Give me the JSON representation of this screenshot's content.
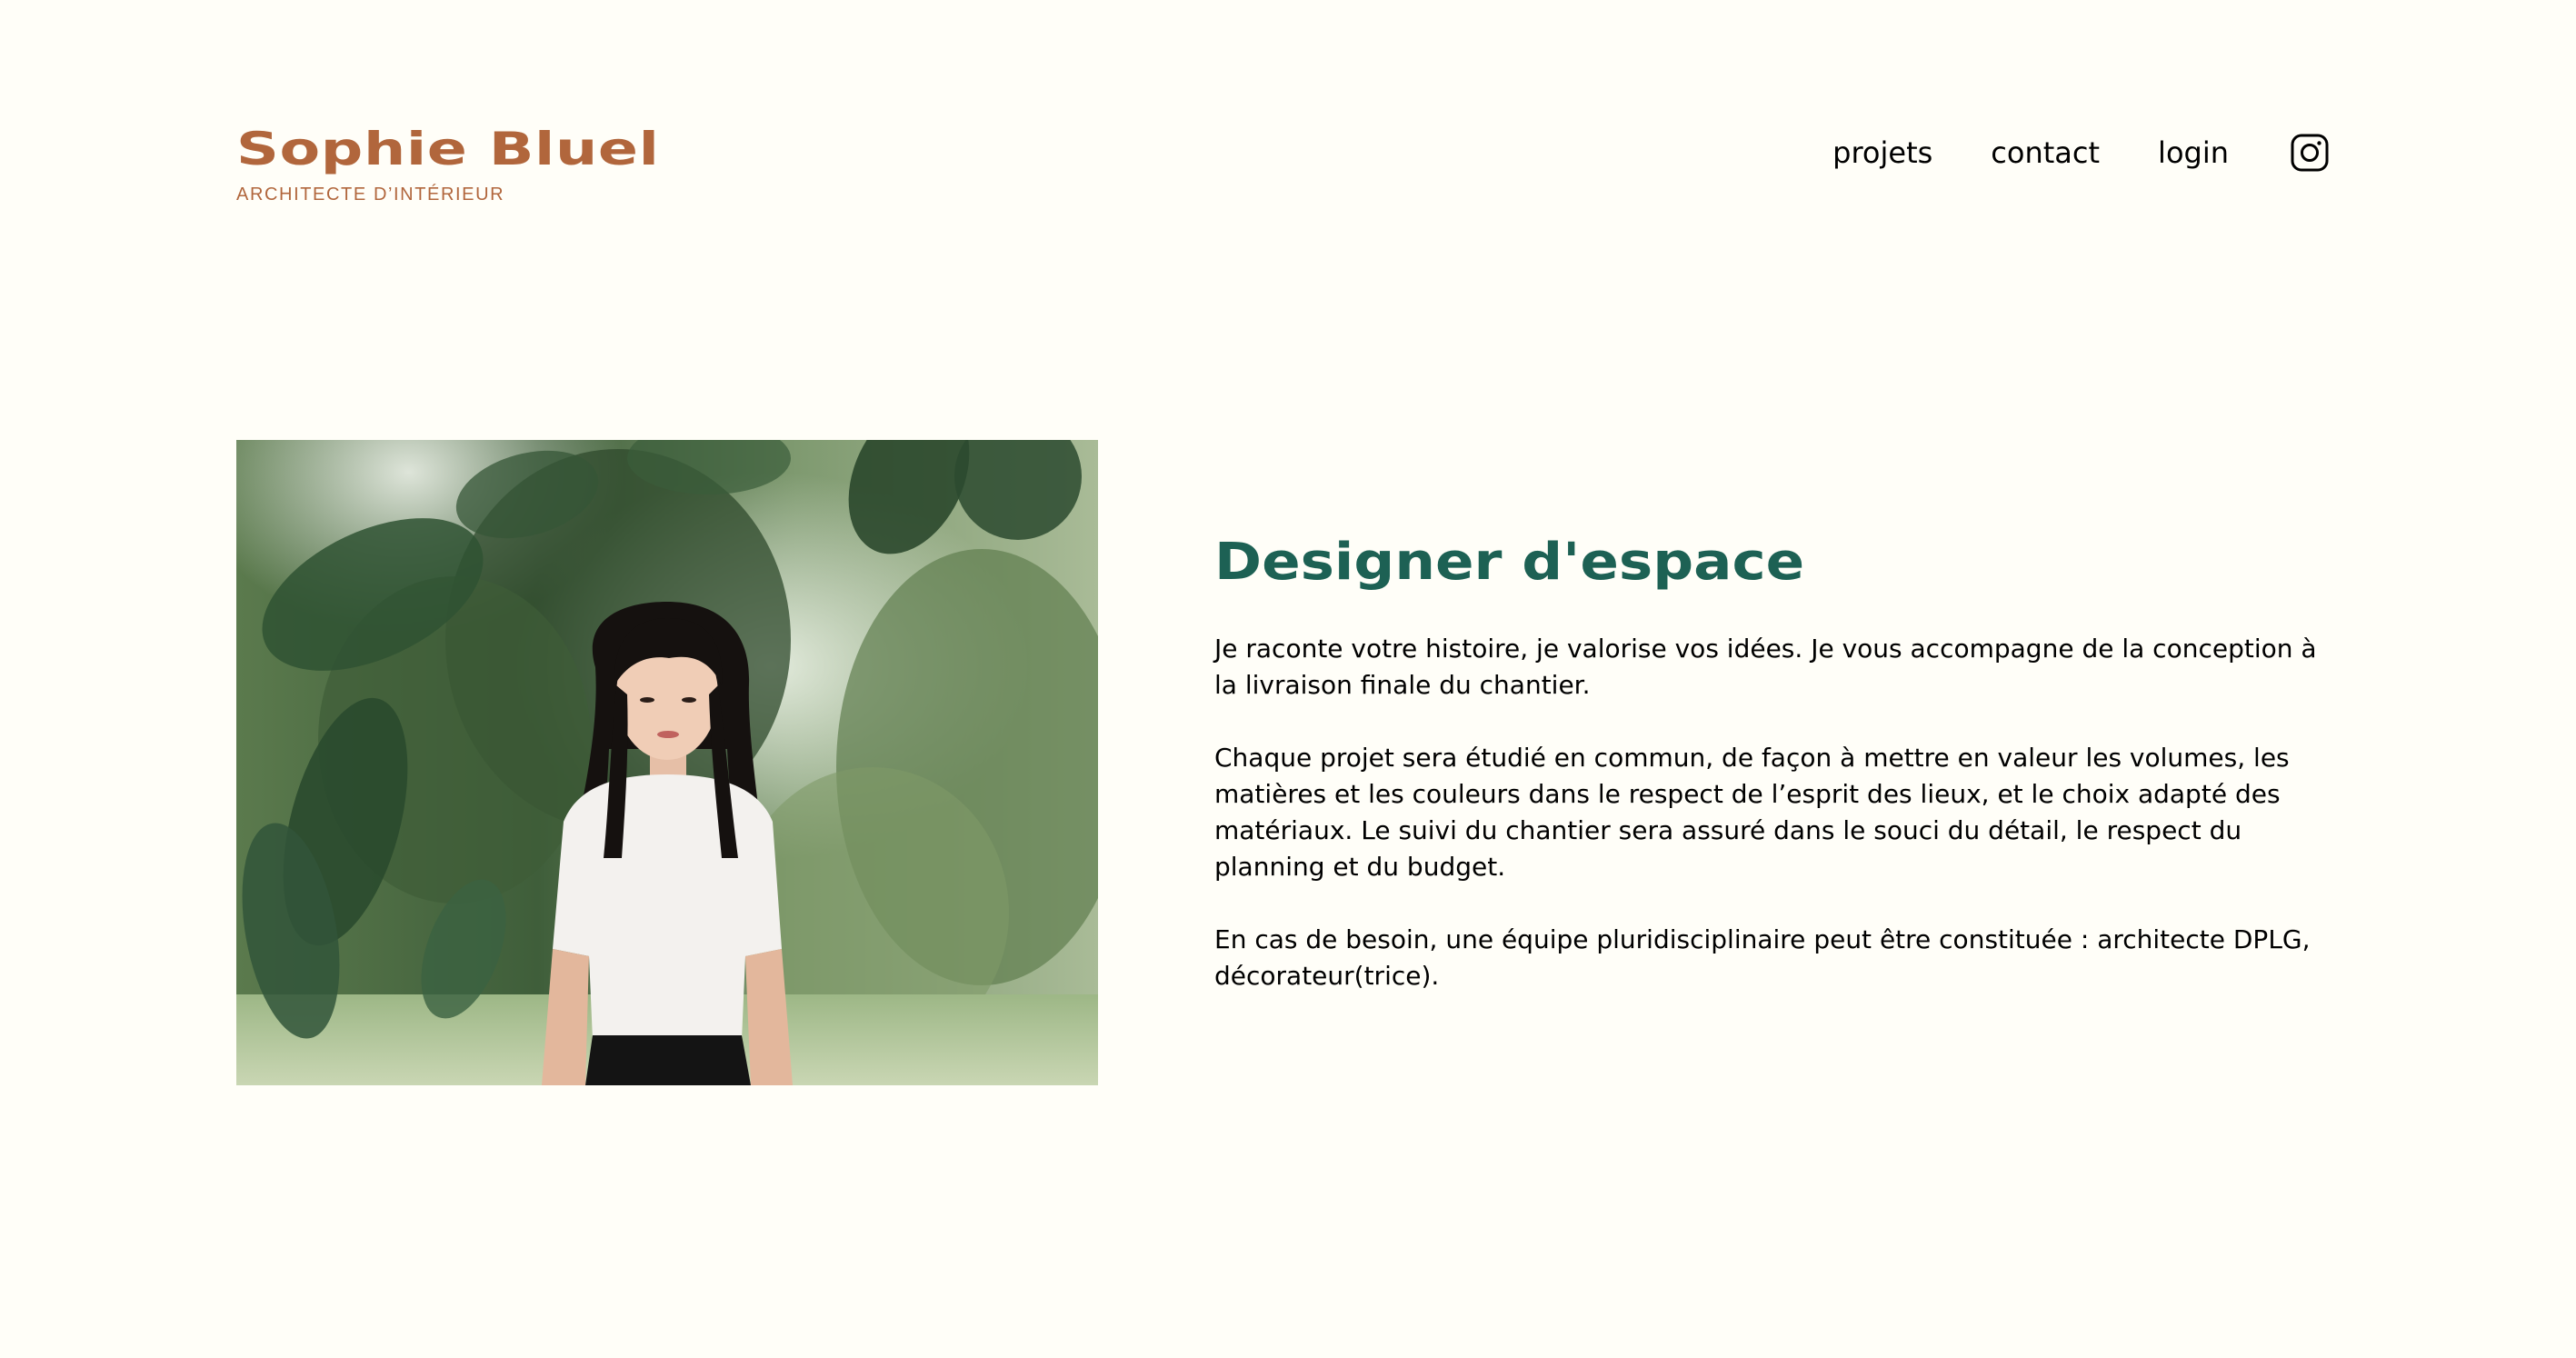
{
  "colors": {
    "background": "#FFFEF8",
    "brand": "#B1663C",
    "title_green": "#1D6154",
    "text": "#000000"
  },
  "header": {
    "logo": {
      "title": "Sophie Bluel",
      "subtitle": "ARCHITECTE D’INTÉRIEUR"
    },
    "nav": {
      "items": [
        {
          "label": "projets"
        },
        {
          "label": "contact"
        },
        {
          "label": "login"
        }
      ],
      "instagram_icon": "instagram-icon"
    }
  },
  "introduction": {
    "photo_icon": "portrait-photo",
    "title": "Designer d'espace",
    "paragraphs": [
      "Je raconte votre histoire, je valorise vos idées. Je vous accompagne de la conception à la livraison finale du chantier.",
      "Chaque projet sera étudié en commun, de façon à mettre en valeur les volumes, les matières et les couleurs dans le respect de l’esprit des lieux, et le choix adapté des matériaux. Le suivi du chantier sera assuré dans le souci du détail, le respect du planning et du budget.",
      "En cas de besoin, une équipe pluridisciplinaire peut être constituée : architecte DPLG, décorateur(trice)."
    ]
  }
}
